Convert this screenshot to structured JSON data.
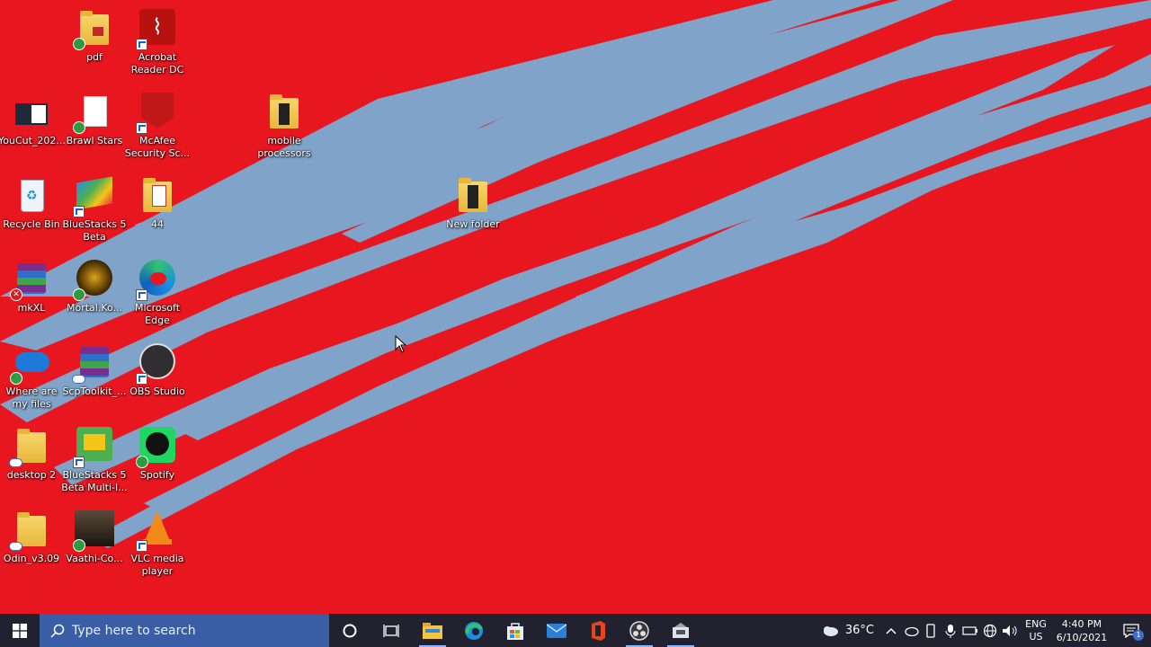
{
  "desktop": {
    "background_color": "#e8161f",
    "streak_color": "#7fa3c9",
    "icons": [
      {
        "id": "pdf",
        "label": "pdf",
        "icon": "pdf-folder-icon"
      },
      {
        "id": "acrobat",
        "label": "Acrobat Reader DC",
        "icon": "acrobat-icon"
      },
      {
        "id": "youcut",
        "label": "YouCut_202...",
        "icon": "video-file-icon"
      },
      {
        "id": "brawl",
        "label": "Brawl Stars",
        "icon": "file-icon"
      },
      {
        "id": "mcafee",
        "label": "McAfee Security Sc...",
        "icon": "mcafee-icon"
      },
      {
        "id": "mobile",
        "label": "mobile processors",
        "icon": "folder-icon"
      },
      {
        "id": "recycle",
        "label": "Recycle Bin",
        "icon": "recycle-bin-icon"
      },
      {
        "id": "bluestacks",
        "label": "BlueStacks 5 Beta",
        "icon": "bluestacks-icon"
      },
      {
        "id": "f44",
        "label": "44",
        "icon": "folder-icon"
      },
      {
        "id": "newfolder",
        "label": "New folder",
        "icon": "folder-icon"
      },
      {
        "id": "mkxl",
        "label": "mkXL",
        "icon": "winrar-icon"
      },
      {
        "id": "mortal",
        "label": "Mortal.Ko...",
        "icon": "mortal-kombat-icon"
      },
      {
        "id": "edge",
        "label": "Microsoft Edge",
        "icon": "edge-icon"
      },
      {
        "id": "onedrive",
        "label": "Where are my files",
        "icon": "onedrive-icon"
      },
      {
        "id": "scp",
        "label": "ScpToolkit_...",
        "icon": "winrar-icon"
      },
      {
        "id": "obs",
        "label": "OBS Studio",
        "icon": "obs-icon"
      },
      {
        "id": "desktop2",
        "label": "desktop 2",
        "icon": "folder-icon"
      },
      {
        "id": "bsmulti",
        "label": "BlueStacks 5 Beta Multi-I...",
        "icon": "bluestacks-multi-icon"
      },
      {
        "id": "spotify",
        "label": "Spotify",
        "icon": "spotify-icon"
      },
      {
        "id": "odin",
        "label": "Odin_v3.09",
        "icon": "folder-icon"
      },
      {
        "id": "vaathi",
        "label": "Vaathi-Co...",
        "icon": "image-file-icon"
      },
      {
        "id": "vlc",
        "label": "VLC media player",
        "icon": "vlc-icon"
      }
    ]
  },
  "taskbar": {
    "search_placeholder": "Type here to search",
    "pinned": [
      "file-explorer-icon",
      "edge-icon",
      "store-icon",
      "mail-icon",
      "office-icon",
      "obs-icon",
      "app-icon"
    ],
    "weather": "36°C",
    "lang_line1": "ENG",
    "lang_line2": "US",
    "time": "4:40 PM",
    "date": "6/10/2021",
    "notifications": "1",
    "colors": {
      "bar": "#21212f",
      "search": "#3a5ea6"
    }
  }
}
